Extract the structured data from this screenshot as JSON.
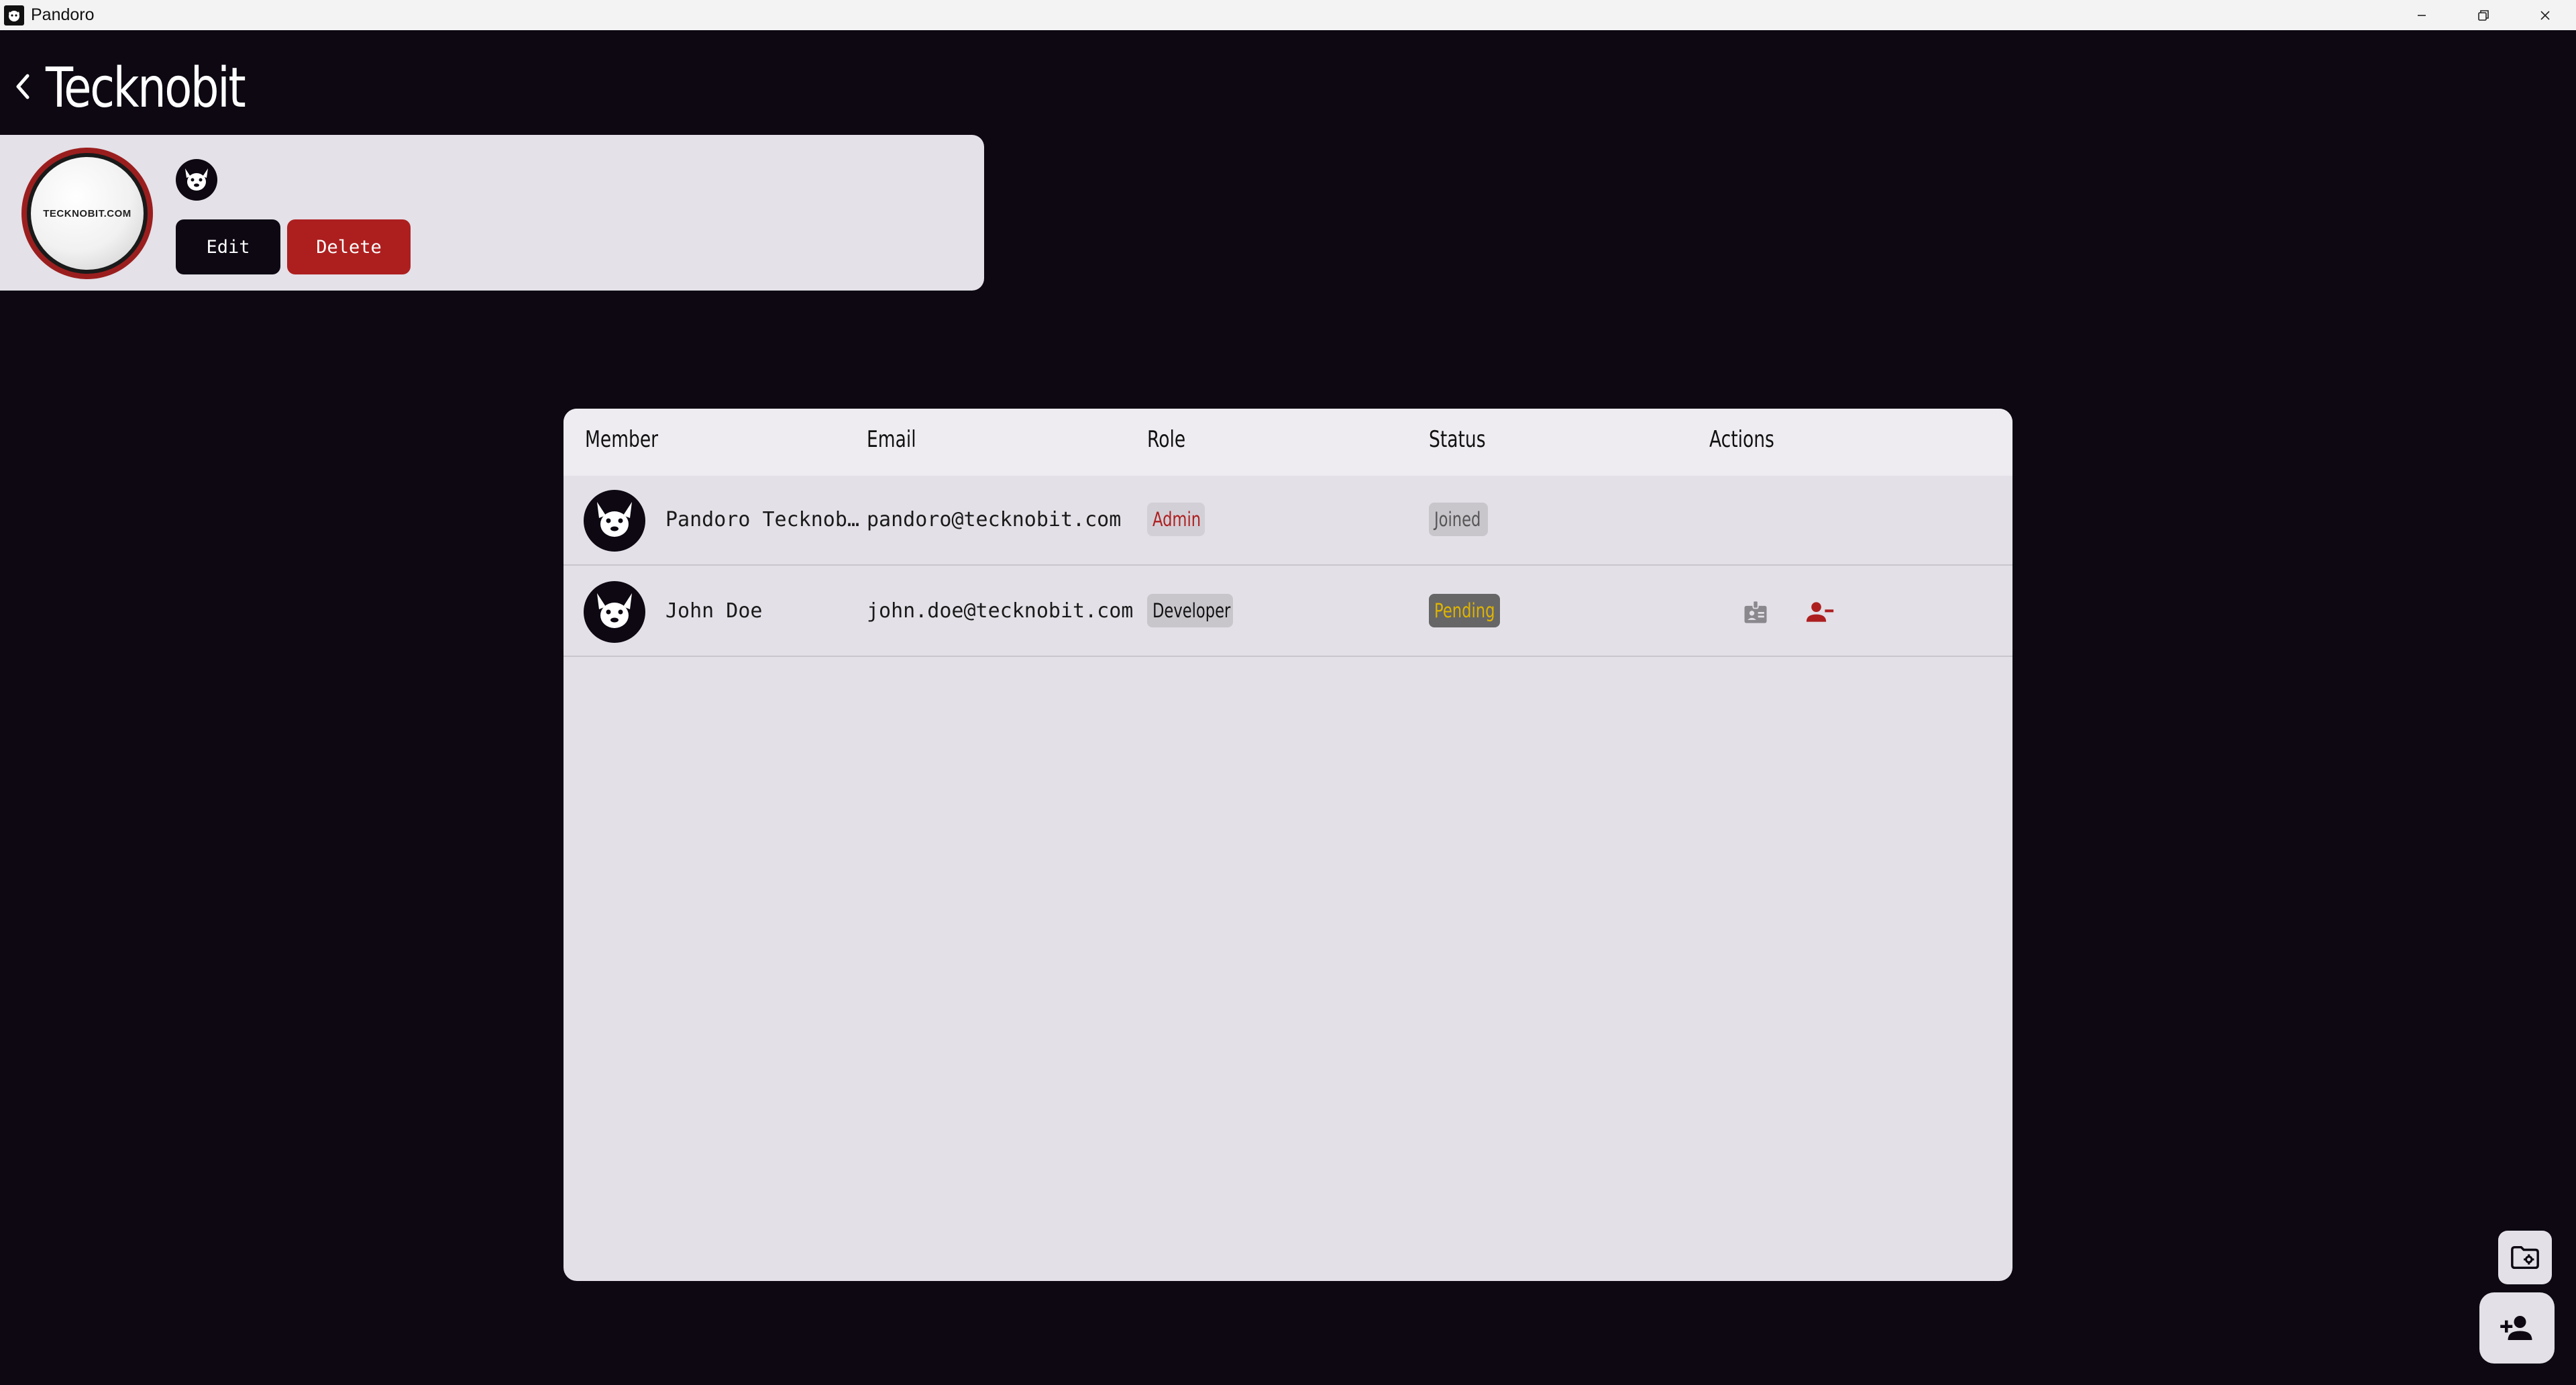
{
  "window": {
    "app_name": "Pandoro"
  },
  "header": {
    "title": "Tecknobit"
  },
  "company": {
    "logo_text": "TECKNOBIT.COM",
    "edit_label": "Edit",
    "delete_label": "Delete",
    "colors": {
      "edit": "#0d0812",
      "delete": "#ad1f1f"
    }
  },
  "members_table": {
    "columns": [
      "Member",
      "Email",
      "Role",
      "Status",
      "Actions"
    ],
    "rows": [
      {
        "name": "Pandoro Tecknobit",
        "email": "pandoro@tecknobit.com",
        "role": "Admin",
        "status": "Joined",
        "actions": []
      },
      {
        "name": "John Doe",
        "email": "john.doe@tecknobit.com",
        "role": "Developer",
        "status": "Pending",
        "actions": [
          "badge-icon",
          "person-remove-icon"
        ]
      }
    ]
  },
  "fabs": {
    "small_icon": "folder-settings-icon",
    "large_icon": "person-add-icon"
  },
  "colors": {
    "background": "#0d0812",
    "panel": "#e3e0e7",
    "accent_red": "#ad1f1f",
    "pending_yellow": "#e0b400"
  }
}
